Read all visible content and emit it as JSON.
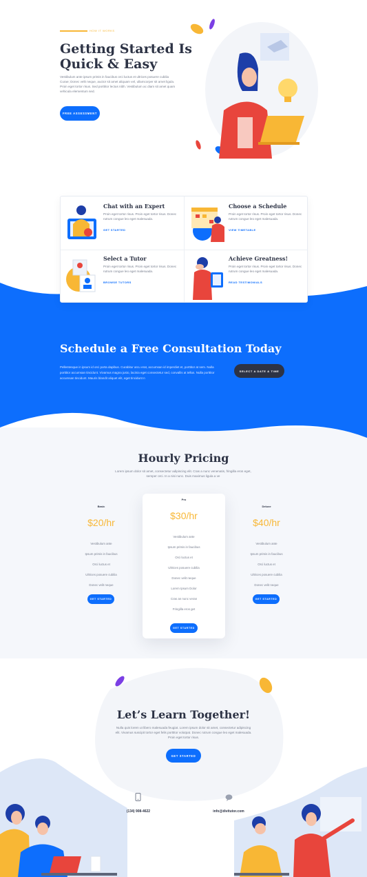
{
  "hero": {
    "eyebrow": "HOW IT WORKS",
    "title_line1": "Getting Started Is",
    "title_line2": "Quick & Easy",
    "body": "Vestibulum ante ipsum primis in faucibus orci luctus et ultrices posuere cubilia Curae; Donec velit neque, auctor sit amet aliquam vel, ullamcorper sit amet ligula. Proin eget tortor risus. Sed porttitor lectus nibh. Vestibulum ac diam sit amet quam vehicula elementum sed.",
    "button": "FREE ASSESSMENT"
  },
  "steps": [
    {
      "title": "Chat with an Expert",
      "text": "Proin eget tortor risus. Proin eget tortor risus. Donec rutrum congue leo eget malesuada.",
      "link": "GET STARTED"
    },
    {
      "title": "Choose a Schedule",
      "text": "Proin eget tortor risus. Proin eget tortor risus. Donec rutrum congue leo eget malesuada.",
      "link": "VIEW TIMETABLE"
    },
    {
      "title": "Select a Tutor",
      "text": "Proin eget tortor risus. Proin eget tortor risus. Donec rutrum congue leo eget malesuada.",
      "link": "BROWSE TUTORS"
    },
    {
      "title": "Achieve Greatness!",
      "text": "Proin eget tortor risus. Proin eget tortor risus. Donec rutrum congue leo eget malesuada.",
      "link": "READ TESTIMONIALS"
    }
  ],
  "consult": {
    "title": "Schedule a Free Consultation Today",
    "body": "Pellentesque in ipsum id orci porta dapibus. Curabitur arcu erat, accumsan id imperdiet et, porttitor at sem. Nulla porttitor accumsan tincidunt. Vivamus magna justo, lacinia eget consectetur sed, convallis at tellus. Nulla porttitor accumsan tincidunt. Mauris blandit aliquet elit, eget tincidunt n",
    "button": "SELECT A DATE & TIME"
  },
  "pricing": {
    "title": "Hourly Pricing",
    "subtitle": "Lorem ipsum dolor sit amet, consectetur adipiscing elit. Cras a nunc venenatis, fringilla eros eget, semper orci. In a nisi nunc. Duis maximus ligula a ve",
    "plans": [
      {
        "name": "Basic",
        "price": "$20/hr",
        "features": [
          "Vestibulum ante",
          "Ipsum primis in faucibus",
          "Orci luctus et",
          "Ultrices posuere cubilia",
          "Donec velit neque"
        ],
        "button": "GET STARTED"
      },
      {
        "name": "Pro",
        "price": "$30/hr",
        "features": [
          "Vestibulum ante",
          "Ipsum primis in faucibus",
          "Orci luctus et",
          "Ultrices posuere cubilia",
          "Donec velit neque",
          "Lorem Ipsum Dolor",
          "Cras an nunc veran",
          "Fringilla eros get"
        ],
        "button": "GET STARTED"
      },
      {
        "name": "Deluxe",
        "price": "$40/hr",
        "features": [
          "Vestibulum ante",
          "Ipsum primis in faucibus",
          "Orci luctus et",
          "Ultrices posuere cubilia",
          "Donec velit neque"
        ],
        "button": "GET STARTED"
      }
    ]
  },
  "learn": {
    "title": "Let’s Learn Together!",
    "body": "Nulla quis lorem ut libero malesuada feugiat. Lorem ipsum dolor sit amet, consectetur adipiscing elit. Vivamus suscipit tortor eget felis porttitor volutpat. Donec rutrum congue leo eget malesuada. Proin eget tortor risus.",
    "button": "GET STARTED"
  },
  "contact": {
    "phone": "(134) 908-4622",
    "email": "info@divitutor.com"
  },
  "colors": {
    "accent": "#0d6efd",
    "gold": "#f8b735",
    "dark": "#2d3345",
    "red": "#e8453c"
  },
  "icons": [
    "phone-icon",
    "chat-bubble-icon",
    "lightbulb-icon",
    "laptop-icon"
  ]
}
